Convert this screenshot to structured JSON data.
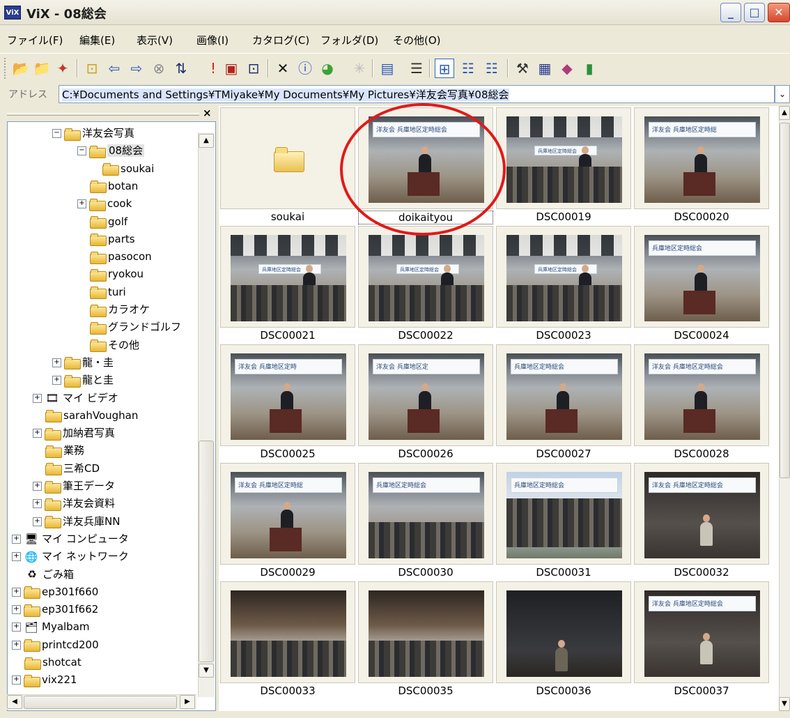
{
  "window": {
    "title": "ViX - 08総会",
    "app_icon": "ViX",
    "buttons": {
      "minimize": "_",
      "maximize": "□",
      "close": "✕"
    }
  },
  "menu": [
    "ファイル(F)",
    "編集(E)",
    "表示(V)",
    "画像(I)",
    "カタログ(C)",
    "フォルダ(D)",
    "その他(O)"
  ],
  "toolbar": {
    "icons": [
      "open-folder-icon",
      "new-folder-icon",
      "explorer-icon",
      "up-folder-icon",
      "back-icon",
      "forward-icon",
      "stop-icon",
      "sort-icon",
      "alert-icon",
      "slideshow-icon",
      "info-icon",
      "delete-icon",
      "properties-icon",
      "color-icon",
      "effects-icon",
      "view-icon",
      "list-icon",
      "large-thumbs-icon",
      "details-icon",
      "small-thumbs-icon",
      "tools-icon",
      "vix-icon",
      "catalog-icon",
      "exit-icon"
    ]
  },
  "address": {
    "label": "アドレス",
    "path": "C:¥Documents and Settings¥TMiyake¥My Documents¥My Pictures¥洋友会写真¥08総会",
    "dropdown": "⌄"
  },
  "tree": {
    "close_label": "×",
    "nodes": [
      {
        "label": "洋友会写真",
        "expander": "⊟",
        "icon": "folder"
      },
      {
        "label": "08総会",
        "expander": "⊟",
        "icon": "folder",
        "selected": true
      },
      {
        "label": "soukai",
        "expander": "",
        "icon": "folder"
      },
      {
        "label": "botan",
        "expander": "",
        "icon": "folder"
      },
      {
        "label": "cook",
        "expander": "⊞",
        "icon": "folder"
      },
      {
        "label": "golf",
        "expander": "",
        "icon": "folder"
      },
      {
        "label": "parts",
        "expander": "",
        "icon": "folder"
      },
      {
        "label": "pasocon",
        "expander": "",
        "icon": "folder"
      },
      {
        "label": "ryokou",
        "expander": "",
        "icon": "folder"
      },
      {
        "label": "turi",
        "expander": "",
        "icon": "folder"
      },
      {
        "label": "カラオケ",
        "expander": "",
        "icon": "folder"
      },
      {
        "label": "グランドゴルフ",
        "expander": "",
        "icon": "folder"
      },
      {
        "label": "その他",
        "expander": "",
        "icon": "folder"
      },
      {
        "label": "龍・圭",
        "expander": "⊞",
        "icon": "folder"
      },
      {
        "label": "龍と圭",
        "expander": "⊞",
        "icon": "folder"
      },
      {
        "label": "マイ ビデオ",
        "expander": "⊞",
        "icon": "video"
      },
      {
        "label": "sarahVoughan",
        "expander": "",
        "icon": "folder"
      },
      {
        "label": "加納君写真",
        "expander": "⊞",
        "icon": "folder"
      },
      {
        "label": "業務",
        "expander": "",
        "icon": "folder"
      },
      {
        "label": "三希CD",
        "expander": "",
        "icon": "folder"
      },
      {
        "label": "筆王データ",
        "expander": "⊞",
        "icon": "folder"
      },
      {
        "label": "洋友会資料",
        "expander": "⊞",
        "icon": "folder"
      },
      {
        "label": "洋友兵庫NN",
        "expander": "⊞",
        "icon": "folder"
      },
      {
        "label": "マイ コンピュータ",
        "expander": "⊞",
        "icon": "computer"
      },
      {
        "label": "マイ ネットワーク",
        "expander": "⊞",
        "icon": "network"
      },
      {
        "label": "ごみ箱",
        "expander": "",
        "icon": "recycle"
      },
      {
        "label": "ep301f660",
        "expander": "⊞",
        "icon": "folder"
      },
      {
        "label": "ep301f662",
        "expander": "⊞",
        "icon": "folder"
      },
      {
        "label": "Myalbam",
        "expander": "⊞",
        "icon": "album"
      },
      {
        "label": "printcd200",
        "expander": "⊞",
        "icon": "folder"
      },
      {
        "label": "shotcat",
        "expander": "",
        "icon": "folder"
      },
      {
        "label": "vix221",
        "expander": "⊞",
        "icon": "folder"
      }
    ]
  },
  "thumbnails": [
    {
      "caption": "soukai",
      "kind": "folder"
    },
    {
      "caption": "doikaityou",
      "kind": "speaker",
      "banner": "洋友会 兵庫地区定時総会",
      "focused": true
    },
    {
      "caption": "DSC00019",
      "kind": "hall",
      "banner": "兵庫地区定時総会"
    },
    {
      "caption": "DSC00020",
      "kind": "speaker",
      "banner": "洋友会 兵庫地区定時総"
    },
    {
      "caption": "DSC00021",
      "kind": "hall",
      "banner": "兵庫地区定時総会"
    },
    {
      "caption": "DSC00022",
      "kind": "hall",
      "banner": "兵庫地区定時総会"
    },
    {
      "caption": "DSC00023",
      "kind": "hall",
      "banner": "兵庫地区定時総会"
    },
    {
      "caption": "DSC00024",
      "kind": "speaker",
      "banner": "兵庫地区定時総会"
    },
    {
      "caption": "DSC00025",
      "kind": "speaker",
      "banner": "洋友会 兵庫地区定時"
    },
    {
      "caption": "DSC00026",
      "kind": "speaker",
      "banner": "洋友会 兵庫地区定"
    },
    {
      "caption": "DSC00027",
      "kind": "speaker",
      "banner": "兵庫地区定時総会"
    },
    {
      "caption": "DSC00028",
      "kind": "speaker",
      "banner": "洋友会 兵庫地区定時総会"
    },
    {
      "caption": "DSC00029",
      "kind": "speaker",
      "banner": "洋友会 兵庫地区定時総"
    },
    {
      "caption": "DSC00030",
      "kind": "crowd",
      "banner": "兵庫地区定時総会"
    },
    {
      "caption": "DSC00031",
      "kind": "group",
      "banner": "兵庫地区定時総会"
    },
    {
      "caption": "DSC00032",
      "kind": "stage",
      "banner": "洋友会 兵庫地区定時総会"
    },
    {
      "caption": "DSC00033",
      "kind": "party",
      "banner": ""
    },
    {
      "caption": "DSC00035",
      "kind": "party",
      "banner": ""
    },
    {
      "caption": "DSC00036",
      "kind": "dark",
      "banner": ""
    },
    {
      "caption": "DSC00037",
      "kind": "stage",
      "banner": "洋友会 兵庫地区定時総会"
    }
  ],
  "colors": {
    "annotation": "#e01a1a",
    "titlebar_close": "#d9452a"
  }
}
